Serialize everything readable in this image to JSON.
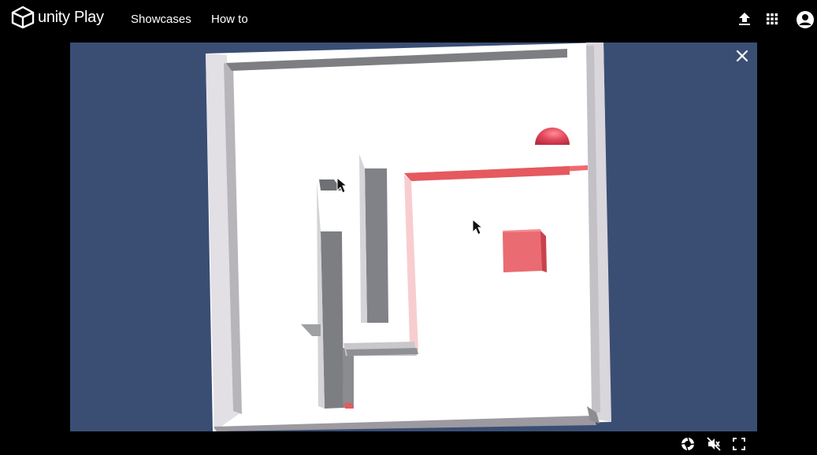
{
  "header": {
    "logo_text": "unity Play",
    "nav": {
      "showcases": "Showcases",
      "how_to": "How to"
    },
    "icons": [
      "upload-icon",
      "apps-grid-icon",
      "account-icon"
    ]
  },
  "game": {
    "background_color": "#3a4e74",
    "overlay_icons": [
      "close-icon"
    ],
    "controls": [
      "screenshot-icon",
      "mute-icon",
      "fullscreen-icon"
    ]
  },
  "colors": {
    "topbar": "#000000",
    "accent_red": "#e5595f",
    "wall_gray": "#7f8287",
    "floor": "#ffffff"
  }
}
